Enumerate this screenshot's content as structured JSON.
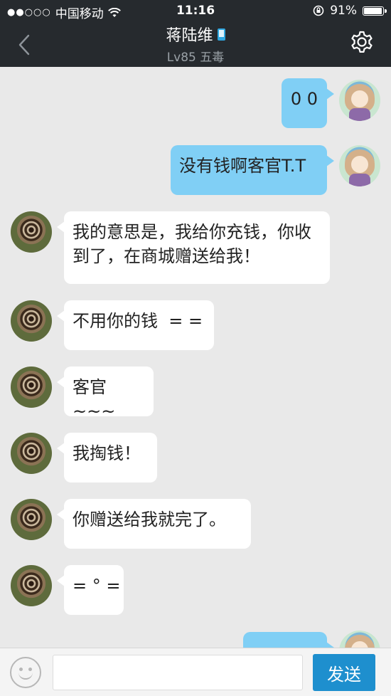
{
  "status_bar": {
    "signal": "●●○○○",
    "carrier": "中国移动",
    "time": "11:16",
    "battery": "91%"
  },
  "header": {
    "title": "蒋陆维",
    "subtitle": "Lv85 五毒"
  },
  "messages": [
    {
      "side": "me",
      "text": "0 0"
    },
    {
      "side": "me",
      "text": "没有钱啊客官T.T"
    },
    {
      "side": "them",
      "text": "我的意思是，我给你充钱，你收到了，在商城赠送给我！"
    },
    {
      "side": "them",
      "text": "不用你的钱  = ="
    },
    {
      "side": "them",
      "text": "客官~~~"
    },
    {
      "side": "them",
      "text": "我掏钱！"
    },
    {
      "side": "them",
      "text": "你赠送给我就完了。"
    },
    {
      "side": "them",
      "text": "= ° ="
    }
  ],
  "input_bar": {
    "placeholder": "",
    "send_label": "发送"
  }
}
